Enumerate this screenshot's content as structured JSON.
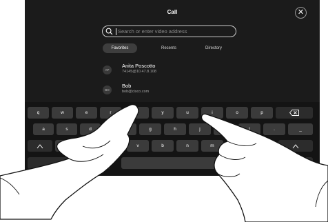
{
  "header": {
    "title": "Call",
    "close_symbol": "✕"
  },
  "search": {
    "placeholder": "Search or enter video address"
  },
  "tabs": [
    {
      "label": "Favorites",
      "active": true
    },
    {
      "label": "Recents",
      "active": false
    },
    {
      "label": "Directory",
      "active": false
    }
  ],
  "contacts": [
    {
      "initials": "AP",
      "name": "Anita Poscotto",
      "detail": "74145@10.47.8.108"
    },
    {
      "initials": "BO",
      "name": "Bob",
      "detail": "bob@cisco.com"
    }
  ],
  "keyboard": {
    "row1": [
      "q",
      "w",
      "e",
      "r",
      "t",
      "y",
      "u",
      "i",
      "o",
      "p"
    ],
    "row2": [
      "a",
      "s",
      "d",
      "f",
      "g",
      "h",
      "j",
      "k",
      "l",
      ".",
      "_"
    ],
    "row3": [
      "z",
      "x",
      "c",
      "v",
      "b",
      "n",
      "m"
    ],
    "backspace_icon": "backspace-icon",
    "shift_icon": "shift-icon"
  },
  "colors": {
    "background": "#1b1b1b",
    "key": "#3b3b3b",
    "text": "#ffffff"
  }
}
